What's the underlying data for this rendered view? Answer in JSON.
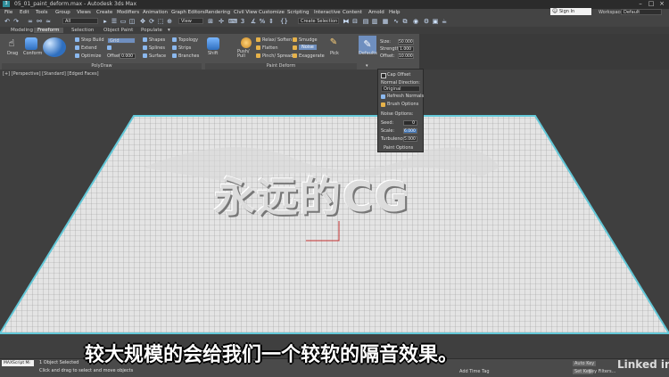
{
  "window": {
    "title": "05_01_paint_deform.max - Autodesk 3ds Max"
  },
  "menu": [
    "File",
    "Edit",
    "Tools",
    "Group",
    "Views",
    "Create",
    "Modifiers",
    "Animation",
    "Graph Editors",
    "Rendering",
    "Civil View",
    "Customize",
    "Scripting",
    "Interactive",
    "Content",
    "Arnold",
    "Help"
  ],
  "toolbar": {
    "filter_dropdown": "All",
    "view_dropdown": "View",
    "selection_set": "Create Selection Se"
  },
  "account": {
    "sign_in": "Sign In",
    "workspaces_label": "Workspaces:",
    "workspace_value": "Default"
  },
  "ribbon_tabs": [
    "Modeling",
    "Freeform",
    "Selection",
    "Object Paint",
    "Populate"
  ],
  "ribbon": {
    "polydraw": {
      "drag": "Drag",
      "conform": "Conform",
      "step_build": "Step Build",
      "extend": "Extend",
      "optimize": "Optimize",
      "grid": "Grid",
      "offset_label": "Offset:",
      "offset_value": "0.000",
      "shapes": "Shapes",
      "splines": "Splines",
      "surface": "Surface",
      "topology": "Topology",
      "strips": "Strips",
      "branches": "Branches",
      "panel_title": "PolyDraw"
    },
    "paint_deform": {
      "shift": "Shift",
      "push_pull": "Push/ Pull",
      "relax_soften": "Relax/ Soften",
      "flatten": "Flatten",
      "pinch_spread": "Pinch/ Spread",
      "smudge": "Smudge",
      "noise": "Noise",
      "exaggerate": "Exaggerate",
      "pick": "Pick",
      "defaults": "Defaults",
      "panel_title": "Paint Deform"
    },
    "brush": {
      "size_label": "Size:",
      "size_value": "50.000",
      "strength_label": "Strength:",
      "strength_value": "1.000",
      "offset_label": "Offset:",
      "offset_value": "10.000"
    }
  },
  "flyout": {
    "cap_offset": "Cap Offset",
    "normal_direction": "Normal Direction:",
    "normal_value": "Original",
    "refresh_normals": "Refresh Normals",
    "brush_options": "Brush Options",
    "noise_options": "Noise Options:",
    "seed_label": "Seed:",
    "seed_value": "0",
    "scale_label": "Scale:",
    "scale_value": "6.000",
    "turbulence_label": "Turbulence:",
    "turbulence_value": "5.000",
    "paint_options": "Paint Options"
  },
  "viewport": {
    "label": "[+] [Perspective] [Standard] [Edged Faces]"
  },
  "status": {
    "maxscript": "MAXScript Mi",
    "line1": "1 Object Selected",
    "line2": "Click and drag to select and move objects",
    "add_time_tag": "Add Time Tag",
    "auto_key": "Auto Key",
    "set_key": "Set Key",
    "key_filters": "Key Filters..."
  },
  "overlay": {
    "watermark": "永远的CG",
    "subtitle": "较大规模的会给我们一个较软的隔音效果。",
    "brand": "Linked in"
  },
  "colors": {
    "accent": "#3b8fe8",
    "mesh_edge": "#63c8d8"
  }
}
